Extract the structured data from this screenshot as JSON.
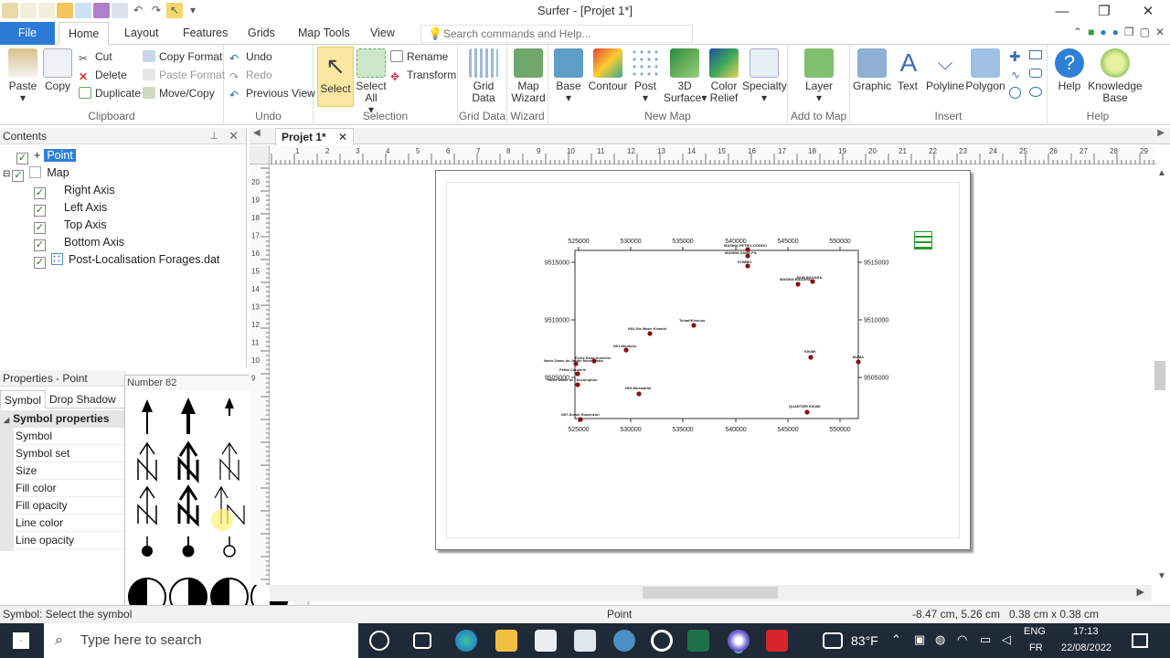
{
  "window": {
    "title": "Surfer - [Projet 1*]"
  },
  "ribbon_tabs": [
    {
      "label": "File"
    },
    {
      "label": "Home"
    },
    {
      "label": "Layout"
    },
    {
      "label": "Features"
    },
    {
      "label": "Grids"
    },
    {
      "label": "Map Tools"
    },
    {
      "label": "View"
    }
  ],
  "search": {
    "placeholder": "Search commands and Help..."
  },
  "groups": {
    "clipboard": {
      "label": "Clipboard",
      "paste": "Paste",
      "copy": "Copy",
      "cut": "Cut",
      "delete": "Delete",
      "duplicate": "Duplicate",
      "copy_format": "Copy Format",
      "paste_format": "Paste Format",
      "move_copy": "Move/Copy"
    },
    "undo": {
      "label": "Undo",
      "undo": "Undo",
      "redo": "Redo",
      "previous_view": "Previous View"
    },
    "selection": {
      "label": "Selection",
      "select": "Select",
      "select_all": "Select All",
      "rename": "Rename",
      "transform": "Transform"
    },
    "grid_data": {
      "label": "Grid Data",
      "btn": "Grid Data"
    },
    "wizard": {
      "label": "Wizard",
      "btn": "Map Wizard"
    },
    "new_map": {
      "label": "New Map",
      "base": "Base",
      "contour": "Contour",
      "post": "Post",
      "surface": "3D Surface",
      "color_relief": "Color Relief",
      "specialty": "Specialty"
    },
    "add_to_map": {
      "label": "Add to Map",
      "layer": "Layer"
    },
    "insert": {
      "label": "Insert",
      "graphic": "Graphic",
      "text": "Text",
      "polyline": "Polyline",
      "polygon": "Polygon"
    },
    "help": {
      "label": "Help",
      "help": "Help",
      "kb": "Knowledge Base"
    }
  },
  "contents": {
    "title": "Contents",
    "items": [
      {
        "label": "Point"
      },
      {
        "label": "Map"
      },
      {
        "label": "Right Axis"
      },
      {
        "label": "Left Axis"
      },
      {
        "label": "Top Axis"
      },
      {
        "label": "Bottom Axis"
      },
      {
        "label": "Post-Localisation Forages.dat"
      }
    ]
  },
  "properties": {
    "title": "Properties - Point",
    "tabs": [
      "Symbol",
      "Drop Shadow"
    ],
    "section": "Symbol properties",
    "rows": [
      "Symbol",
      "Symbol set",
      "Size",
      "Fill color",
      "Fill opacity",
      "Line color",
      "Line opacity"
    ]
  },
  "symbol_picker": {
    "hover_label": "Number 82"
  },
  "document": {
    "tab": "Projet 1*"
  },
  "hruler_labels": [
    "1",
    "2",
    "3",
    "4",
    "5",
    "6",
    "7",
    "8",
    "9",
    "10",
    "11",
    "12",
    "13",
    "14",
    "15",
    "16",
    "17",
    "18",
    "19",
    "20",
    "21",
    "22",
    "23",
    "24",
    "25",
    "26",
    "27",
    "28",
    "29"
  ],
  "vruler_labels": [
    "20",
    "19",
    "18",
    "17",
    "16",
    "15",
    "14",
    "13",
    "12",
    "11",
    "10",
    "9"
  ],
  "map": {
    "top_ticks": [
      "525000",
      "530000",
      "535000",
      "540000",
      "545000",
      "550000"
    ],
    "bottom_ticks": [
      "525000",
      "530000",
      "535000",
      "540000",
      "545000",
      "550000"
    ],
    "left_ticks": [
      "9515000",
      "9510000",
      "9505000"
    ],
    "right_ticks": [
      "9515000",
      "9510000",
      "9505000"
    ],
    "points": [
      {
        "label": "MASINA PETRO-CONGO"
      },
      {
        "label": "MASINA SANS-FIL"
      },
      {
        "label": "KOMBO"
      },
      {
        "label": "MASINA BADARA"
      },
      {
        "label": "BOB BADARA"
      },
      {
        "label": "Tchad/Kinsoso"
      },
      {
        "label": "N04-Ste Marie Kisanbi"
      },
      {
        "label": "N01-Munkolo"
      },
      {
        "label": "Ecole Saint Anselme"
      },
      {
        "label": "Notre Dame du Jardin Mont-Amba"
      },
      {
        "label": "Petite Cenderie"
      },
      {
        "label": "Notre Dame de l'Assomption"
      },
      {
        "label": "N03-Mussabha"
      },
      {
        "label": "KIKIMI"
      },
      {
        "label": "BUMA"
      },
      {
        "label": "QUARTIER KIKIMI"
      },
      {
        "label": "N07-Sivalo Ruwenzori"
      }
    ]
  },
  "status": {
    "left": "Symbol: Select the symbol",
    "mid": "Point",
    "coords": "-8.47 cm, 5.26 cm",
    "size": "0.38 cm x 0.38 cm"
  },
  "taskbar": {
    "search_placeholder": "Type here to search",
    "temp": "83°F",
    "lang1": "ENG",
    "lang2": "FR",
    "time": "17:13",
    "date": "22/08/2022"
  },
  "colors": {
    "accent": "#2b7bd6",
    "selection": "#2f7fd7",
    "point": "#8b1010",
    "taskbar": "#1f2a38"
  }
}
